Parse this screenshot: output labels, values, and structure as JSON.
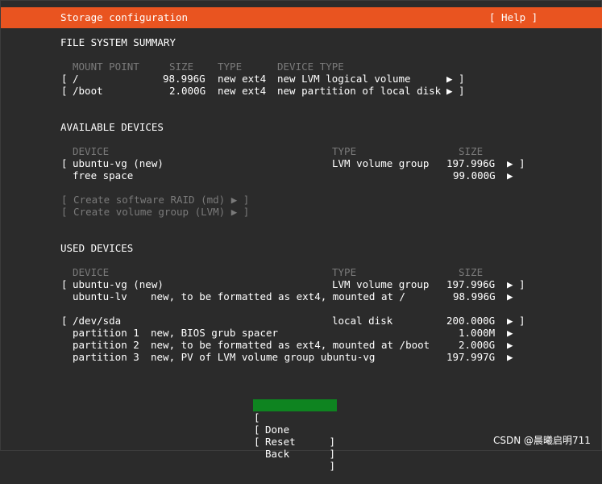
{
  "header": {
    "title": "Storage configuration",
    "help": "[ Help ]"
  },
  "fs_summary": {
    "heading": "FILE SYSTEM SUMMARY",
    "columns": {
      "mount": "MOUNT POINT",
      "size": "SIZE",
      "type": "TYPE",
      "device_type": "DEVICE TYPE"
    },
    "rows": [
      {
        "open": "[",
        "mount": "/",
        "size": "98.996G",
        "type": "new ext4",
        "device_type": "new LVM logical volume",
        "arrow": "▶ ]"
      },
      {
        "open": "[",
        "mount": "/boot",
        "size": "2.000G",
        "type": "new ext4",
        "device_type": "new partition of local disk",
        "arrow": "▶ ]"
      }
    ]
  },
  "available": {
    "heading": "AVAILABLE DEVICES",
    "columns": {
      "device": "DEVICE",
      "type": "TYPE",
      "size": "SIZE"
    },
    "rows": [
      {
        "open": "[",
        "device": "ubuntu-vg (new)",
        "type": "LVM volume group",
        "size": "197.996G",
        "arrow": "▶ ]"
      },
      {
        "open": "",
        "device": "free space",
        "type": "",
        "size": "99.000G",
        "arrow": "▶"
      }
    ],
    "actions": [
      "[ Create software RAID (md) ▶ ]",
      "[ Create volume group (LVM) ▶ ]"
    ]
  },
  "used": {
    "heading": "USED DEVICES",
    "columns": {
      "device": "DEVICE",
      "type": "TYPE",
      "size": "SIZE"
    },
    "vg": {
      "open": "[",
      "device": "ubuntu-vg (new)",
      "type": "LVM volume group",
      "size": "197.996G",
      "arrow": "▶ ]",
      "children": [
        {
          "name": "ubuntu-lv",
          "desc": "new, to be formatted as ext4, mounted at /",
          "size": "98.996G",
          "arrow": "▶"
        }
      ]
    },
    "disk": {
      "open": "[",
      "device": "/dev/sda",
      "type": "local disk",
      "size": "200.000G",
      "arrow": "▶ ]",
      "children": [
        {
          "name": "partition 1",
          "desc": "new, BIOS grub spacer",
          "size": "1.000M",
          "arrow": "▶"
        },
        {
          "name": "partition 2",
          "desc": "new, to be formatted as ext4, mounted at /boot",
          "size": "2.000G",
          "arrow": "▶"
        },
        {
          "name": "partition 3",
          "desc": "new, PV of LVM volume group ubuntu-vg",
          "size": "197.997G",
          "arrow": "▶"
        }
      ]
    }
  },
  "buttons": {
    "open": "[",
    "close": "]",
    "done": "Done",
    "reset": "Reset",
    "back": "Back"
  },
  "watermark": "CSDN @晨曦启明711",
  "colors": {
    "accent": "#e95420",
    "selected": "#0e8420",
    "background": "#2b2b2b",
    "dim": "#7a7a7a"
  }
}
